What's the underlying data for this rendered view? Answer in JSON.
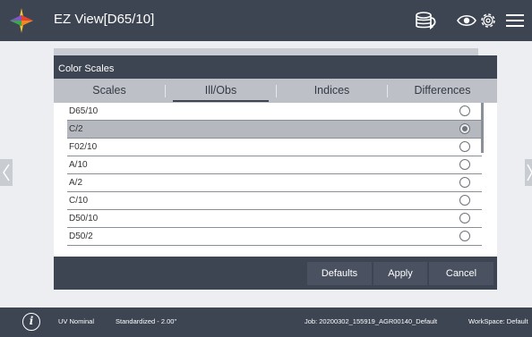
{
  "header": {
    "title": "EZ View[D65/10]",
    "icons": [
      "app-logo-icon",
      "database-sync-icon",
      "eye-icon",
      "gear-icon",
      "menu-icon"
    ]
  },
  "dialog": {
    "title": "Color Scales",
    "tabs": [
      {
        "label": "Scales",
        "active": false
      },
      {
        "label": "Ill/Obs",
        "active": true
      },
      {
        "label": "Indices",
        "active": false
      },
      {
        "label": "Differences",
        "active": false
      }
    ],
    "options": [
      {
        "label": "D65/10",
        "selected": false
      },
      {
        "label": "C/2",
        "selected": true
      },
      {
        "label": "F02/10",
        "selected": false
      },
      {
        "label": "A/10",
        "selected": false
      },
      {
        "label": "A/2",
        "selected": false
      },
      {
        "label": "C/10",
        "selected": false
      },
      {
        "label": "D50/10",
        "selected": false
      },
      {
        "label": "D50/2",
        "selected": false
      }
    ],
    "buttons": {
      "defaults": "Defaults",
      "apply": "Apply",
      "cancel": "Cancel"
    }
  },
  "statusbar": {
    "uv": "UV Nominal",
    "standardized": "Standardized - 2.00\"",
    "job": "Job: 20200302_155919_AGR00140_Default",
    "workspace": "WorkSpace: Default"
  },
  "colors": {
    "bar": "#3d4452",
    "tab_strip": "#bdc1c7",
    "selected_row": "#b5b9bf",
    "button": "#4a5160",
    "background": "#eceef1"
  }
}
